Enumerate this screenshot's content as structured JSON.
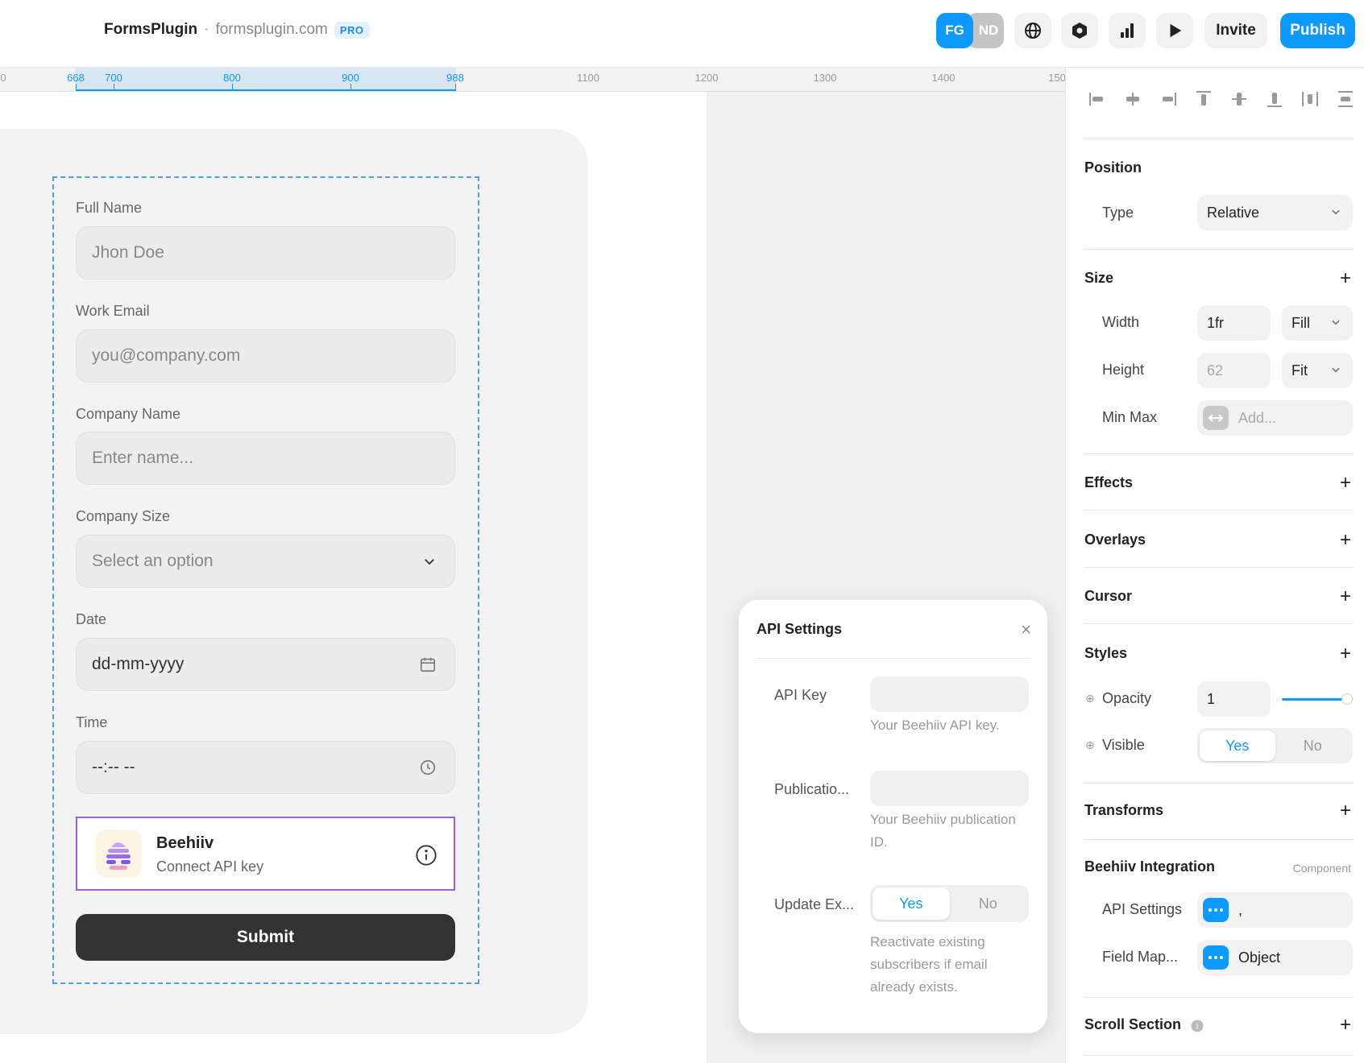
{
  "topbar": {
    "brand_name": "FormsPlugin",
    "brand_sep": "·",
    "brand_domain": "formsplugin.com",
    "plan_badge": "PRO",
    "avatars": [
      "FG",
      "ND"
    ],
    "icons": [
      "globe-icon",
      "settings-hex-icon",
      "analytics-icon",
      "play-icon"
    ],
    "invite_label": "Invite",
    "publish_label": "Publish",
    "accent_color": "#0d99ff"
  },
  "ruler": {
    "ticks": [
      {
        "label": "0",
        "selected": false
      },
      {
        "label": "668",
        "selected": true
      },
      {
        "label": "700",
        "selected": true
      },
      {
        "label": "800",
        "selected": true
      },
      {
        "label": "900",
        "selected": true
      },
      {
        "label": "988",
        "selected": true
      },
      {
        "label": "1100",
        "selected": false
      },
      {
        "label": "1200",
        "selected": false
      },
      {
        "label": "1300",
        "selected": false
      },
      {
        "label": "1400",
        "selected": false
      },
      {
        "label": "150",
        "selected": false
      }
    ]
  },
  "form": {
    "fields": [
      {
        "label": "Full Name",
        "placeholder": "Jhon Doe"
      },
      {
        "label": "Work Email",
        "placeholder": "you@company.com"
      },
      {
        "label": "Company Name",
        "placeholder": "Enter name..."
      },
      {
        "label": "Company Size",
        "placeholder": "Select an option"
      },
      {
        "label": "Date",
        "placeholder": "dd-mm-yyyy"
      },
      {
        "label": "Time",
        "placeholder": "--:-- --"
      }
    ],
    "integration": {
      "title": "Beehiiv",
      "subtitle": "Connect API key"
    },
    "submit_label": "Submit"
  },
  "api_popup": {
    "title": "API Settings",
    "close": "×",
    "api_key_label": "API Key",
    "api_key_help": "Your Beehiiv API key.",
    "publication_label": "Publicatio...",
    "publication_help": "Your Beehiiv publication ID.",
    "update_label": "Update Ex...",
    "update_yes": "Yes",
    "update_no": "No",
    "update_help": "Reactivate existing subscribers if email already exists."
  },
  "panel": {
    "position": {
      "title": "Position",
      "type_label": "Type",
      "type_value": "Relative"
    },
    "size": {
      "title": "Size",
      "width_label": "Width",
      "width_value": "1fr",
      "width_mode": "Fill",
      "height_label": "Height",
      "height_value": "62",
      "height_mode": "Fit",
      "minmax_label": "Min Max",
      "minmax_placeholder": "Add..."
    },
    "effects": "Effects",
    "overlays": "Overlays",
    "cursor": "Cursor",
    "styles": {
      "title": "Styles",
      "opacity_label": "Opacity",
      "opacity_value": "1",
      "visible_label": "Visible",
      "visible_yes": "Yes",
      "visible_no": "No"
    },
    "transforms": "Transforms",
    "integration": {
      "title": "Beehiiv Integration",
      "tag": "Component",
      "api_settings_label": "API Settings",
      "api_settings_value": ",",
      "field_map_label": "Field Map...",
      "field_map_value": "Object"
    },
    "scroll_section": "Scroll Section"
  }
}
